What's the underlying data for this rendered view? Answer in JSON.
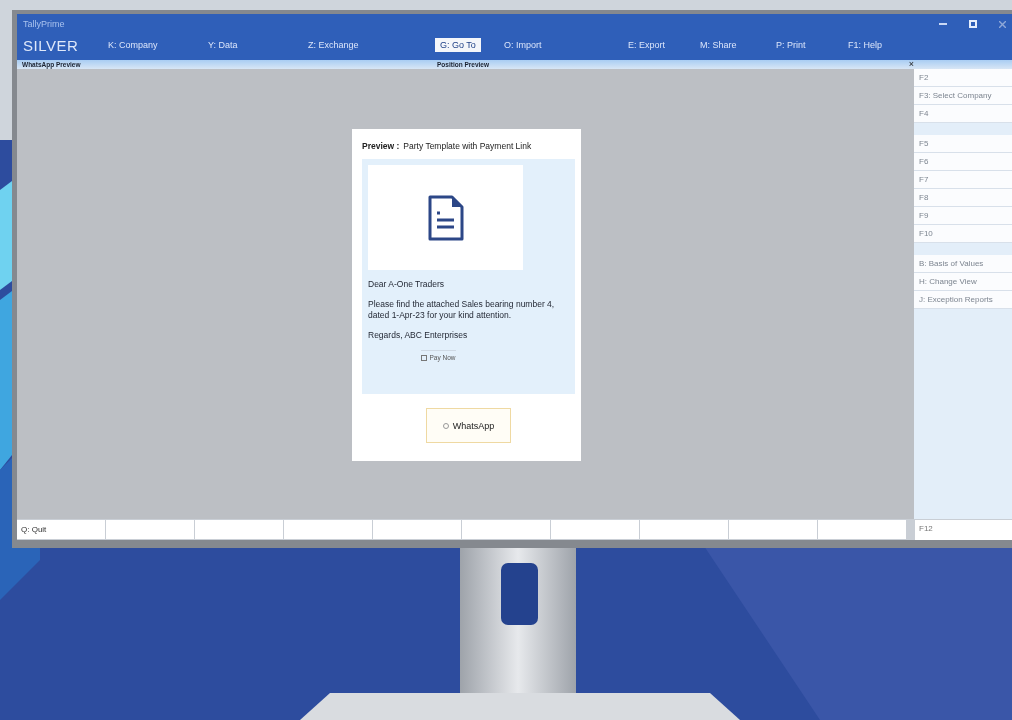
{
  "top_bar": {
    "product": "TallyPrime",
    "edition": "SILVER",
    "menu": [
      {
        "label": "K: Company",
        "selected": false
      },
      {
        "label": "Y: Data",
        "selected": false
      },
      {
        "label": "Z: Exchange",
        "selected": false
      },
      {
        "label": "G: Go To",
        "selected": true
      },
      {
        "label": "O: Import",
        "selected": false
      },
      {
        "label": "E: Export",
        "selected": false
      },
      {
        "label": "M: Share",
        "selected": false
      },
      {
        "label": "P: Print",
        "selected": false
      },
      {
        "label": "F1: Help",
        "selected": false
      }
    ]
  },
  "sub_header": {
    "left": "WhatsApp Preview",
    "center": "Position Preview",
    "close": "×"
  },
  "dialog": {
    "title_label": "Preview :",
    "title": "Party Template with Payment Link",
    "greeting": "Dear A-One Traders",
    "message": "Please find the attached Sales bearing number 4, dated 1-Apr-23 for your kind attention.",
    "signature": "Regards, ABC Enterprises",
    "link": "Pay Now",
    "button": "WhatsApp"
  },
  "side_panel": {
    "groups": [
      {
        "items": [
          "F2",
          "F3: Select Company",
          "F4"
        ]
      },
      {
        "items": [
          "F5",
          "F6",
          "F7",
          "F8",
          "F9",
          "F10"
        ]
      },
      {
        "items": [
          "B: Basis of Values",
          "H: Change View",
          "J: Exception Reports"
        ]
      }
    ],
    "bottom": "F12"
  },
  "bottom_bar": {
    "quit": "Q: Quit"
  }
}
